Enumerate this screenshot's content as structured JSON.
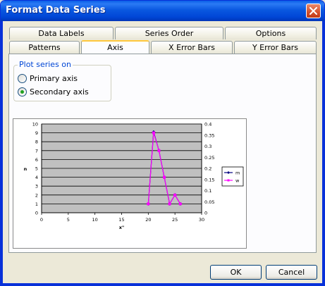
{
  "dialog": {
    "title": "Format Data Series",
    "close_icon": "close-icon"
  },
  "tabs": {
    "row1": [
      "Data Labels",
      "Series Order",
      "Options"
    ],
    "row2": [
      "Patterns",
      "Axis",
      "X Error Bars",
      "Y Error Bars"
    ],
    "active": "Axis"
  },
  "axis_group": {
    "label": "Plot series on",
    "options": [
      {
        "label": "Primary axis",
        "checked": false
      },
      {
        "label": "Secondary axis",
        "checked": true
      }
    ]
  },
  "chart_data": {
    "type": "line",
    "xlabel": "x\"",
    "ylabel": "n",
    "xlim": [
      0,
      30
    ],
    "x_ticks": [
      "0",
      "5",
      "10",
      "15",
      "20",
      "25",
      "30"
    ],
    "ylim_primary": [
      0,
      10
    ],
    "y_ticks_primary": [
      "0",
      "1",
      "2",
      "3",
      "4",
      "5",
      "6",
      "7",
      "8",
      "9",
      "10"
    ],
    "ylim_secondary": [
      0,
      0.4
    ],
    "y_ticks_secondary": [
      "0",
      "0.05",
      "0.1",
      "0.15",
      "0.2",
      "0.25",
      "0.3",
      "0.35",
      "0.4"
    ],
    "plot_background": "#c0c0c0",
    "grid": true,
    "legend_position": "right",
    "series": [
      {
        "name": "m",
        "axis": "primary",
        "color": "#000080",
        "marker": "diamond",
        "x": [
          20,
          21,
          22,
          23,
          24,
          25,
          26
        ],
        "y": [
          1,
          9.1,
          7,
          4,
          1,
          2,
          1
        ]
      },
      {
        "name": "w",
        "axis": "secondary",
        "color": "#ff00ff",
        "marker": "square",
        "x": [
          20,
          21,
          22,
          23,
          24,
          25,
          26
        ],
        "y": [
          0.04,
          0.36,
          0.28,
          0.16,
          0.04,
          0.08,
          0.04
        ]
      }
    ]
  },
  "buttons": {
    "ok": "OK",
    "cancel": "Cancel"
  },
  "colors": {
    "title_bar": "#0054e3",
    "frame": "#0831d9",
    "dialog_bg": "#ece9d8",
    "group_label": "#0046d5",
    "active_tab_accent": "#ffc73c"
  }
}
